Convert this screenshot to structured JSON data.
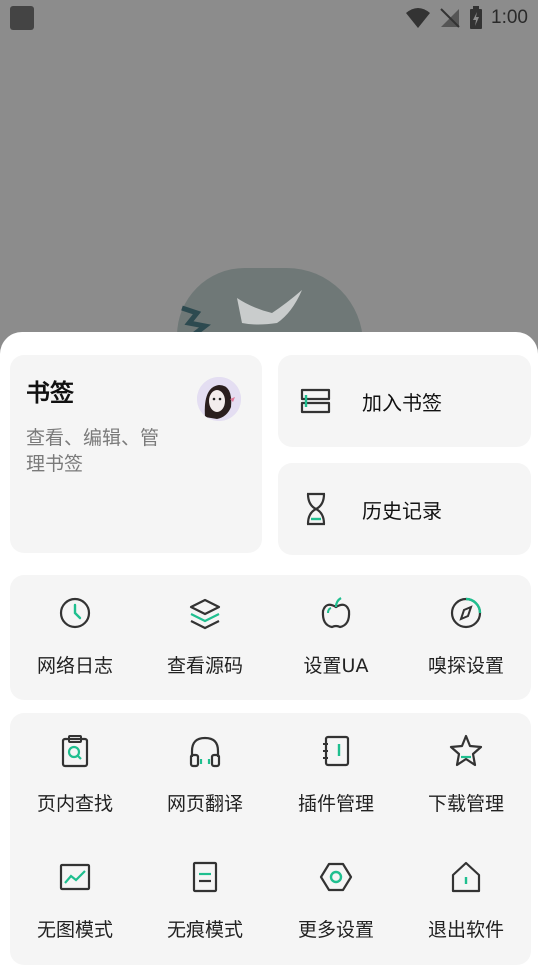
{
  "status_bar": {
    "time": "1:00"
  },
  "bookmarks_card": {
    "title": "书签",
    "subtitle": "查看、编辑、管理书签"
  },
  "actions": {
    "add_bookmark": "加入书签",
    "history": "历史记录"
  },
  "grid_top": [
    {
      "label": "网络日志",
      "icon": "clock-icon"
    },
    {
      "label": "查看源码",
      "icon": "layers-icon"
    },
    {
      "label": "设置UA",
      "icon": "apple-icon"
    },
    {
      "label": "嗅探设置",
      "icon": "compass-icon"
    }
  ],
  "grid_bottom": [
    {
      "label": "页内查找",
      "icon": "clipboard-search-icon"
    },
    {
      "label": "网页翻译",
      "icon": "headphones-icon"
    },
    {
      "label": "插件管理",
      "icon": "notebook-icon"
    },
    {
      "label": "下载管理",
      "icon": "star-icon"
    },
    {
      "label": "无图模式",
      "icon": "image-icon"
    },
    {
      "label": "无痕模式",
      "icon": "document-icon"
    },
    {
      "label": "更多设置",
      "icon": "hexagon-settings-icon"
    },
    {
      "label": "退出软件",
      "icon": "home-icon"
    }
  ],
  "colors": {
    "accent": "#1fbf8f",
    "icon": "#333333",
    "card": "#f5f5f5"
  }
}
